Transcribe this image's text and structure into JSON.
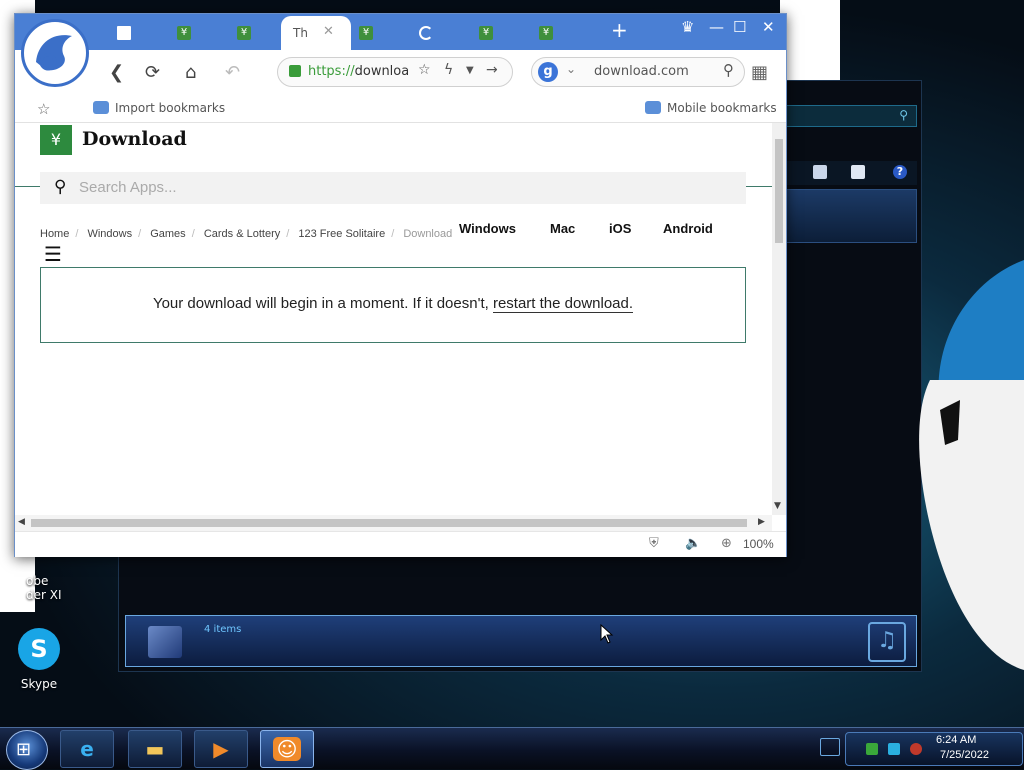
{
  "desktop": {
    "icons": [
      {
        "label": "Skype"
      },
      {
        "label": "obe\nder XI"
      }
    ],
    "background_window": {
      "status_count": "4 items"
    }
  },
  "browser": {
    "tabs": [
      {
        "icon": "page-icon"
      },
      {
        "icon": "download-site-icon"
      },
      {
        "icon": "download-site-icon"
      },
      {
        "icon": "active",
        "label": "Th"
      },
      {
        "icon": "download-site-icon"
      },
      {
        "icon": "loading-icon"
      },
      {
        "icon": "download-site-icon"
      },
      {
        "icon": "download-site-icon"
      }
    ],
    "url": {
      "scheme": "https://",
      "rest": "downloa"
    },
    "search": {
      "engine": "g",
      "text": "download.com"
    },
    "bookmarks": {
      "import_label": "Import bookmarks",
      "mobile_label": "Mobile bookmarks"
    },
    "zoom": "100%"
  },
  "page": {
    "site_name": "Download",
    "search_placeholder": "Search Apps...",
    "breadcrumbs": [
      "Home",
      "Windows",
      "Games",
      "Cards & Lottery",
      "123 Free Solitaire",
      "Download"
    ],
    "platforms": [
      "Windows",
      "Mac",
      "iOS",
      "Android"
    ],
    "notice_text": "Your download will begin in a moment. If it doesn't, ",
    "notice_link": "restart the download."
  },
  "taskbar": {
    "time": "6:24 AM",
    "date": "7/25/2022"
  },
  "colors": {
    "browser_chrome": "#4a7fd4",
    "site_green": "#2d8a3e",
    "secure_green": "#3a9c3a"
  }
}
